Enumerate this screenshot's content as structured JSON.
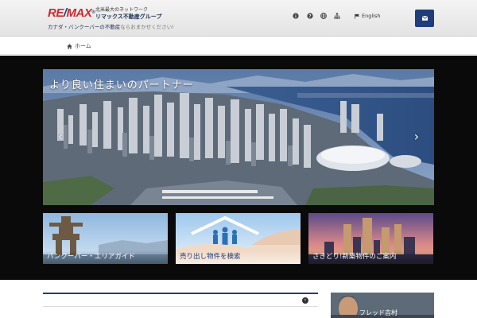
{
  "header": {
    "logo_re": "RE",
    "logo_slash": "/",
    "logo_max": "MAX",
    "logo_reg": "®",
    "brand_tag": "北米最大のネットワーク",
    "brand_name": "リマックス不動産グループ",
    "tagline_main": "カナダ・バンクーバーの",
    "tagline_accent": "不動産",
    "tagline_end": "ならおまかせください!",
    "language_label": "English",
    "icons": [
      "info-icon",
      "question-icon",
      "globe-icon",
      "sitemap-icon",
      "flag-icon",
      "mail-icon"
    ]
  },
  "breadcrumb": {
    "home_icon": "home-icon",
    "label": "ホーム"
  },
  "hero": {
    "title": "より良い住まいのパートナー",
    "prev_symbol": "‹",
    "next_symbol": "›"
  },
  "cards": [
    {
      "label": "バンクーバー・エリアガイド"
    },
    {
      "label": "売り出し物件を検索"
    },
    {
      "label": "さきどり!新築物件のご案内"
    }
  ],
  "profile": {
    "label": "フレッド吉村"
  },
  "colors": {
    "brand_blue": "#1f3d7a",
    "brand_red": "#d6262d",
    "band_black": "#0a0a0a"
  }
}
